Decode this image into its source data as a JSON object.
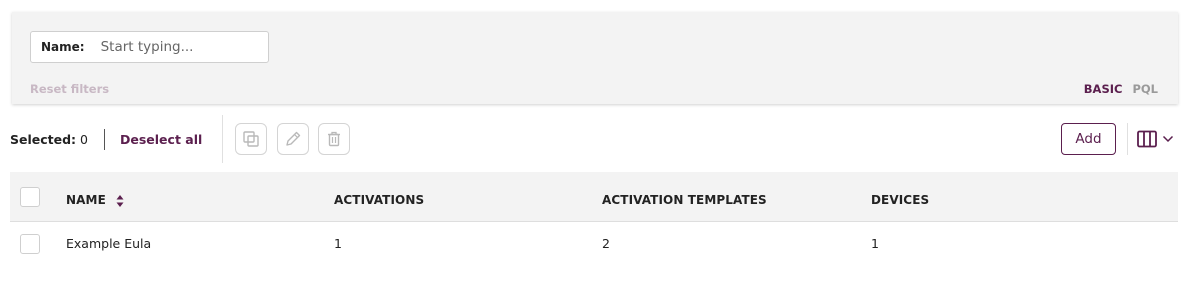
{
  "filters": {
    "name_label": "Name:",
    "name_placeholder": "Start typing...",
    "name_value": "",
    "reset_label": "Reset filters",
    "modes": [
      "BASIC",
      "PQL"
    ],
    "active_mode": "BASIC"
  },
  "toolbar": {
    "selected_label": "Selected:",
    "selected_count": "0",
    "deselect_label": "Deselect all",
    "icons": [
      "copy-icon",
      "edit-icon",
      "delete-icon",
      "columns-icon",
      "chevron-down-icon"
    ],
    "add_label": "Add"
  },
  "table": {
    "headers": [
      "NAME",
      "ACTIVATIONS",
      "ACTIVATION TEMPLATES",
      "DEVICES"
    ],
    "sort_column": "NAME",
    "rows": [
      [
        "Example Eula",
        "1",
        "2",
        "1"
      ]
    ]
  },
  "colors": {
    "accent": "#5b1f4e",
    "panel_bg": "#f3f3f3",
    "disabled_text": "#c8b8c4"
  }
}
